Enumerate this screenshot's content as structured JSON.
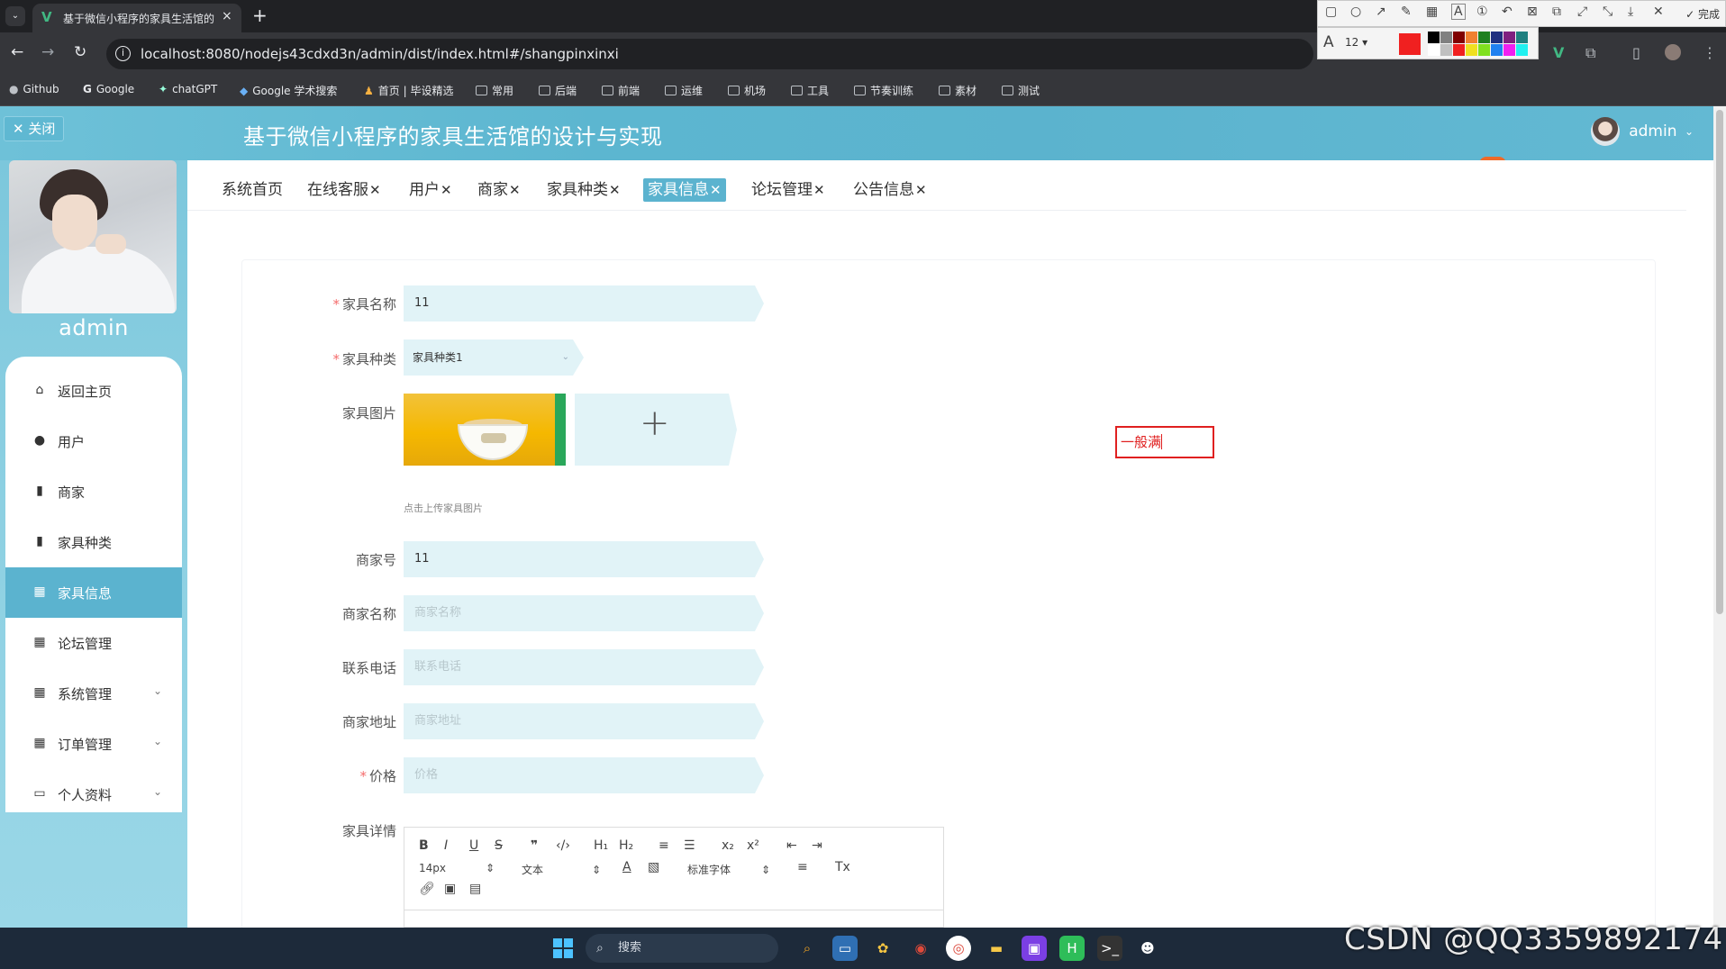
{
  "browser": {
    "tab_title": "基于微信小程序的家具生活馆的",
    "tab_close": "×",
    "new_tab": "+",
    "url": "localhost:8080/nodejs43cdxd3n/admin/dist/index.html#/shangpinxinxi",
    "bookmarks": [
      "Github",
      "Google",
      "chatGPT",
      "Google 学术搜索",
      "首页 | 毕设精选",
      "常用",
      "后端",
      "前端",
      "运维",
      "机场",
      "工具",
      "节奏训练",
      "素材",
      "测试"
    ]
  },
  "snip_tool": {
    "done_label": "✓ 完成",
    "font_size": "12"
  },
  "header": {
    "close_label": "✕ 关闭",
    "title": "基于微信小程序的家具生活馆的设计与实现",
    "username": "admin"
  },
  "sidebar": {
    "profile_name": "admin",
    "items": [
      {
        "label": "返回主页",
        "icon": "home-icon",
        "active": false,
        "expandable": false
      },
      {
        "label": "用户",
        "icon": "user-icon",
        "active": false,
        "expandable": false
      },
      {
        "label": "商家",
        "icon": "shop-icon",
        "active": false,
        "expandable": false
      },
      {
        "label": "家具种类",
        "icon": "category-icon",
        "active": false,
        "expandable": false
      },
      {
        "label": "家具信息",
        "icon": "grid-icon",
        "active": true,
        "expandable": false
      },
      {
        "label": "论坛管理",
        "icon": "grid-icon",
        "active": false,
        "expandable": false
      },
      {
        "label": "系统管理",
        "icon": "grid-icon",
        "active": false,
        "expandable": true
      },
      {
        "label": "订单管理",
        "icon": "grid-icon",
        "active": false,
        "expandable": true
      },
      {
        "label": "个人资料",
        "icon": "profile-icon",
        "active": false,
        "expandable": true
      }
    ]
  },
  "tags": [
    {
      "label": "系统首页",
      "closable": false,
      "active": false
    },
    {
      "label": "在线客服",
      "closable": true,
      "active": false
    },
    {
      "label": "用户",
      "closable": true,
      "active": false
    },
    {
      "label": "商家",
      "closable": true,
      "active": false
    },
    {
      "label": "家具种类",
      "closable": true,
      "active": false
    },
    {
      "label": "家具信息",
      "closable": true,
      "active": true
    },
    {
      "label": "论坛管理",
      "closable": true,
      "active": false
    },
    {
      "label": "公告信息",
      "closable": true,
      "active": false
    }
  ],
  "form": {
    "furniture_name": {
      "label": "家具名称",
      "required": true,
      "value": "11"
    },
    "furniture_type": {
      "label": "家具种类",
      "required": true,
      "value": "家具种类1"
    },
    "furniture_image": {
      "label": "家具图片",
      "upload_tip": "点击上传家具图片"
    },
    "merchant_no": {
      "label": "商家号",
      "value": "11"
    },
    "merchant_name": {
      "label": "商家名称",
      "placeholder": "商家名称"
    },
    "phone": {
      "label": "联系电话",
      "placeholder": "联系电话"
    },
    "address": {
      "label": "商家地址",
      "placeholder": "商家地址"
    },
    "price": {
      "label": "价格",
      "required": true,
      "placeholder": "价格"
    },
    "details": {
      "label": "家具详情"
    }
  },
  "editor": {
    "font_size": "14px",
    "paragraph": "文本",
    "font_family": "标准字体"
  },
  "annotation_text": "一般满",
  "taskbar": {
    "search_placeholder": "搜索"
  },
  "watermark": "CSDN @QQ3359892174",
  "colors": {
    "accent": "#5bb3cf",
    "input_bg": "#e1f3f7",
    "required": "#f56c6c",
    "annotation": "#e02020"
  }
}
